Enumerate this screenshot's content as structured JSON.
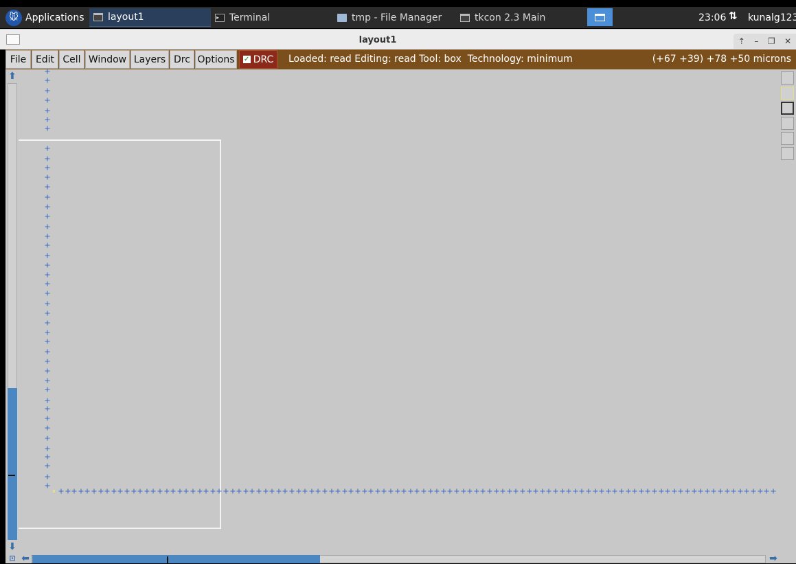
{
  "taskbar": {
    "applications_label": "Applications",
    "tasks": [
      {
        "label": "layout1",
        "icon": "window-icon"
      },
      {
        "label": "Terminal",
        "icon": "terminal-icon"
      },
      {
        "label": "tmp - File Manager",
        "icon": "folder-icon"
      },
      {
        "label": "tkcon 2.3 Main",
        "icon": "window-icon"
      }
    ],
    "clock": "23:06",
    "user": "kunalg123"
  },
  "window": {
    "title": "layout1",
    "controls": [
      "up-arrow-icon",
      "minimize-icon",
      "restore-icon",
      "close-icon"
    ]
  },
  "menubar": {
    "items": [
      "File",
      "Edit",
      "Cell",
      "Window",
      "Layers",
      "Drc",
      "Options"
    ],
    "drc_toggle": {
      "label": "DRC",
      "checked": true
    },
    "status": "Loaded: read Editing: read Tool: box  Technology: minimum",
    "coordinates": "(+67 +39) +78 +50 microns"
  },
  "colors": {
    "menubar_bg": "#7a4f1c",
    "drc_bg": "#8b2a1a",
    "canvas_bg": "#c8c8c8",
    "grid_cross": "#3b6cc4",
    "scroll_thumb": "#4b87c2"
  },
  "scrollbars": {
    "vertical_position": 0.68,
    "horizontal_position": 0.0
  }
}
